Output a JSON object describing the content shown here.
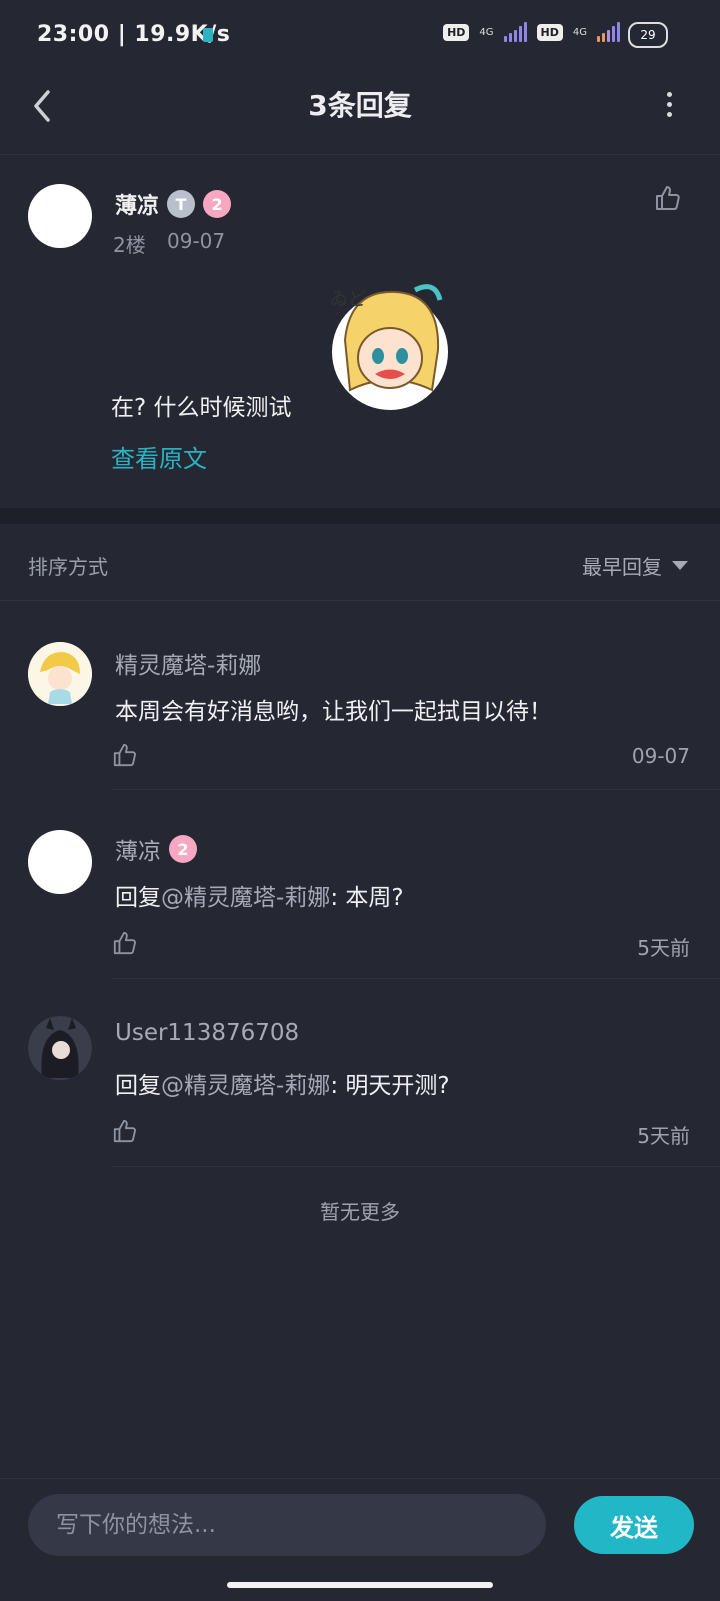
{
  "status_bar": {
    "time_speed": "23:00 | 19.9K/s",
    "hd1": "HD",
    "net1": "4G",
    "hd2": "HD",
    "net2": "4G",
    "battery": "29"
  },
  "header": {
    "title": "3条回复"
  },
  "post": {
    "author": "薄凉",
    "badge_t": "T",
    "badge_level": "2",
    "floor": "2楼",
    "date": "09-07",
    "text": "在? 什么时候测试",
    "view_original": "查看原文"
  },
  "sort": {
    "label": "排序方式",
    "selected": "最早回复"
  },
  "replies": [
    {
      "name": "精灵魔塔-莉娜",
      "prefix": "",
      "mention": "",
      "text": "本周会有好消息哟，让我们一起拭目以待！",
      "time": "09-07"
    },
    {
      "name": "薄凉",
      "badge_level": "2",
      "prefix": "回复",
      "mention": "@精灵魔塔-莉娜",
      "text": ": 本周?",
      "time": "5天前"
    },
    {
      "name": "User113876708",
      "prefix": "回复",
      "mention": "@精灵魔塔-莉娜",
      "text": ": 明天开测?",
      "time": "5天前"
    }
  ],
  "footer_note": "暂无更多",
  "composer": {
    "placeholder": "写下你的想法...",
    "send": "发送"
  }
}
